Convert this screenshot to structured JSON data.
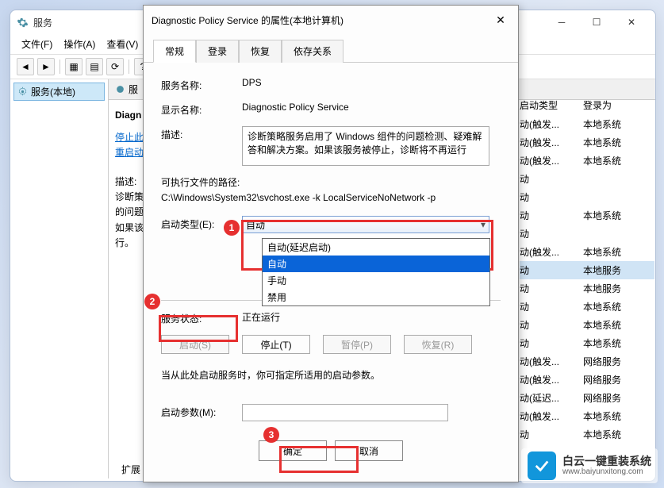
{
  "window": {
    "title": "服务",
    "menu": {
      "file": "文件(F)",
      "action": "操作(A)",
      "view": "查看(V)"
    },
    "tree_root": "服务(本地)",
    "bottom_tabs": "扩展"
  },
  "detail": {
    "title_prefix": "Diagn",
    "stop_link": "停止",
    "restart_link": "重启动",
    "desc_label": "描述:",
    "desc_line1": "诊断策",
    "desc_line2": "的问题",
    "desc_line3": "如果该",
    "desc_line4": "行。"
  },
  "columns": {
    "startup_type": "启动类型",
    "logon_as": "登录为"
  },
  "rows": [
    {
      "c1": "动(触发...",
      "c2": "本地系统"
    },
    {
      "c1": "动(触发...",
      "c2": "本地系统"
    },
    {
      "c1": "动(触发...",
      "c2": "本地系统"
    },
    {
      "c1": "动",
      "c2": ""
    },
    {
      "c1": "动",
      "c2": ""
    },
    {
      "c1": "动",
      "c2": "本地系统"
    },
    {
      "c1": "动",
      "c2": ""
    },
    {
      "c1": "动(触发...",
      "c2": "本地系统"
    },
    {
      "c1": "动",
      "c2": "本地服务",
      "hl": true
    },
    {
      "c1": "动",
      "c2": "本地服务"
    },
    {
      "c1": "动",
      "c2": "本地系统"
    },
    {
      "c1": "动",
      "c2": "本地系统"
    },
    {
      "c1": "动",
      "c2": "本地系统"
    },
    {
      "c1": "动(触发...",
      "c2": "网络服务"
    },
    {
      "c1": "动(触发...",
      "c2": "网络服务"
    },
    {
      "c1": "动(延迟...",
      "c2": "网络服务"
    },
    {
      "c1": "动(触发...",
      "c2": "本地系统"
    },
    {
      "c1": "动",
      "c2": "本地系统"
    }
  ],
  "dialog": {
    "title": "Diagnostic Policy Service 的属性(本地计算机)",
    "tabs": {
      "general": "常规",
      "logon": "登录",
      "recovery": "恢复",
      "deps": "依存关系"
    },
    "service_name_label": "服务名称:",
    "service_name": "DPS",
    "display_name_label": "显示名称:",
    "display_name": "Diagnostic Policy Service",
    "description_label": "描述:",
    "description": "诊断策略服务启用了 Windows 组件的问题检测、疑难解答和解决方案。如果该服务被停止，诊断将不再运行",
    "exec_label": "可执行文件的路径:",
    "exec_path": "C:\\Windows\\System32\\svchost.exe -k LocalServiceNoNetwork -p",
    "startup_type_label": "启动类型(E):",
    "startup_type_selected": "自动",
    "dropdown": {
      "delayed": "自动(延迟启动)",
      "auto": "自动",
      "manual": "手动",
      "disabled": "禁用"
    },
    "status_label": "服务状态:",
    "status_value": "正在运行",
    "btn_start": "启动(S)",
    "btn_stop": "停止(T)",
    "btn_pause": "暂停(P)",
    "btn_resume": "恢复(R)",
    "hint": "当从此处启动服务时，你可指定所适用的启动参数。",
    "param_label": "启动参数(M):",
    "ok": "确定",
    "cancel": "取消"
  },
  "callouts": {
    "n1": "1",
    "n2": "2",
    "n3": "3"
  },
  "watermark": {
    "line1": "白云一键重装系统",
    "line2": "www.baiyunxitong.com"
  }
}
